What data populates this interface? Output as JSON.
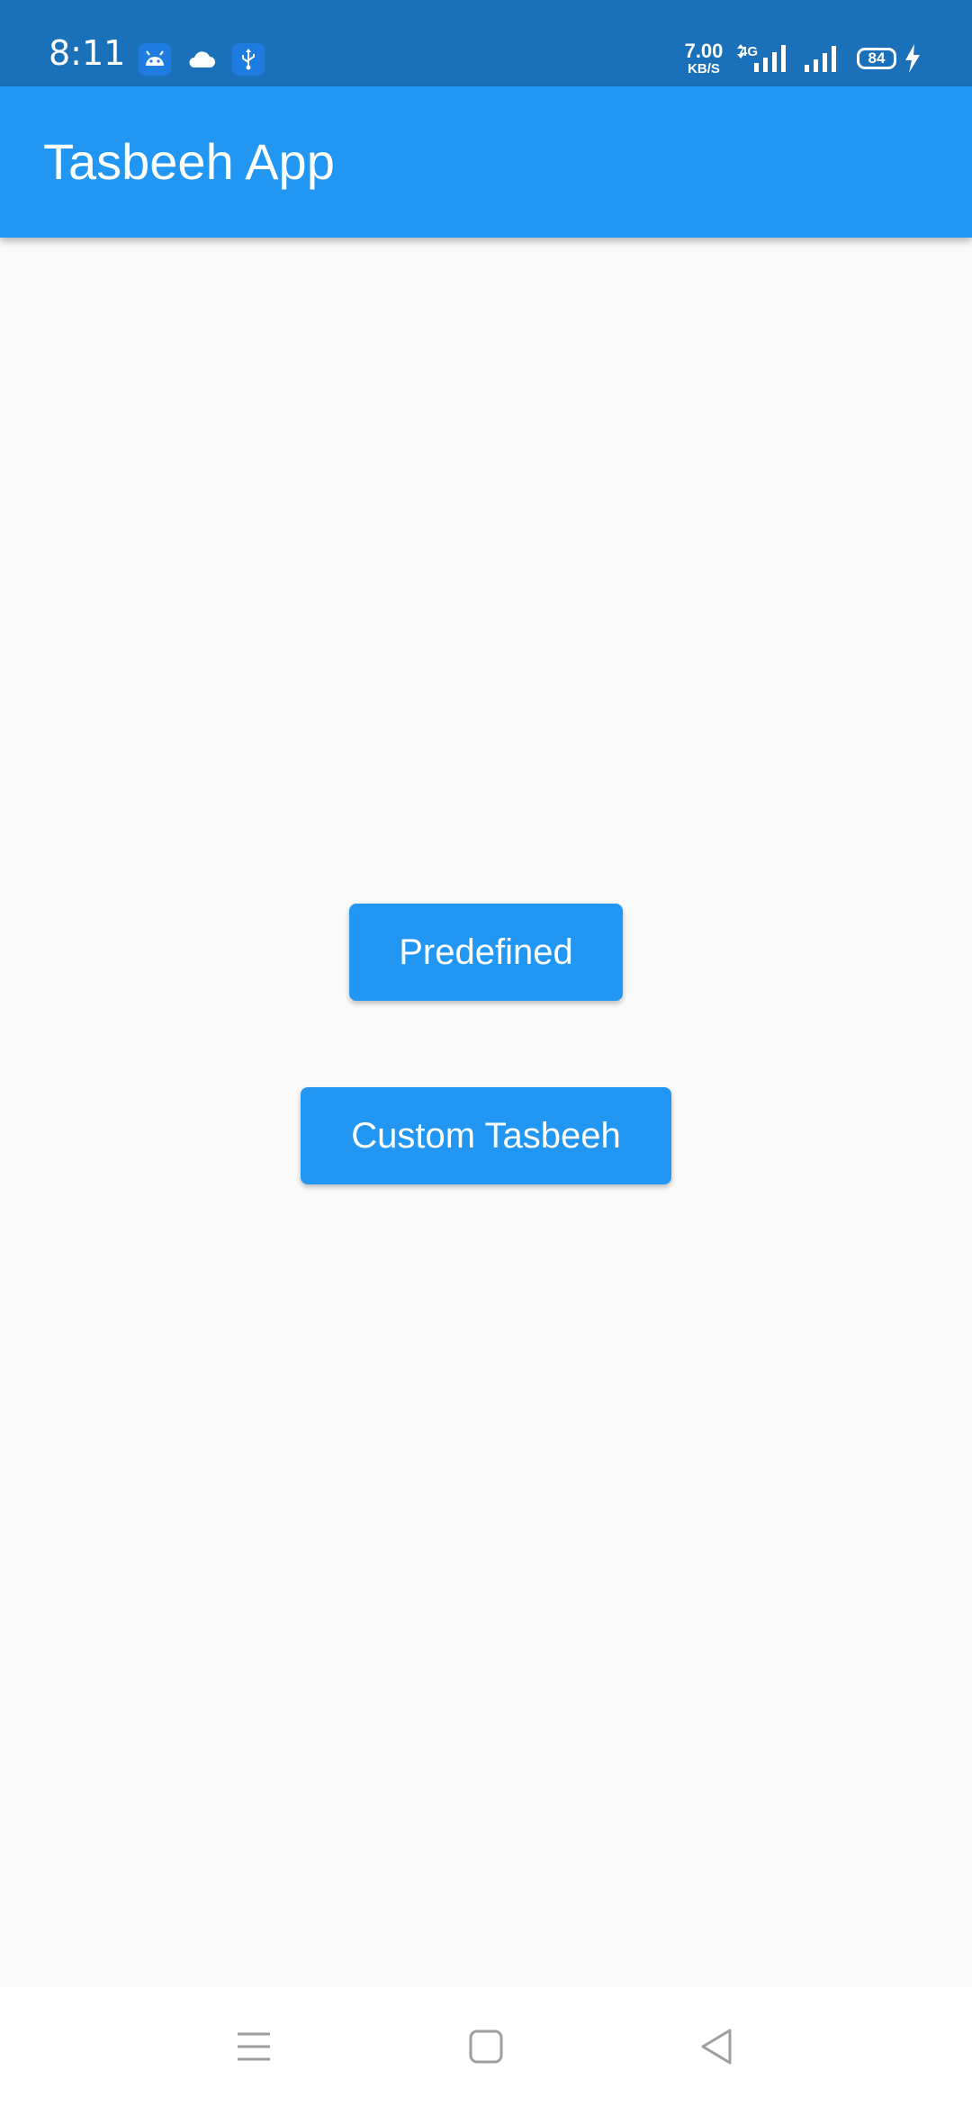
{
  "status_bar": {
    "time": "8:11",
    "notification_icons": [
      "android-icon",
      "cloud-icon",
      "usb-icon"
    ],
    "net_speed_value": "7.00",
    "net_speed_unit": "KB/S",
    "network_type": "4G",
    "battery_level": "84",
    "charging": true,
    "background_color": "#1a70b9"
  },
  "app_bar": {
    "title": "Tasbeeh App",
    "color": "#2196f3"
  },
  "main": {
    "buttons": [
      {
        "label": "Predefined"
      },
      {
        "label": "Custom Tasbeeh"
      }
    ],
    "background_color": "#fafafa"
  },
  "nav_bar": {
    "items": [
      "menu-icon",
      "home-icon",
      "back-icon"
    ]
  }
}
